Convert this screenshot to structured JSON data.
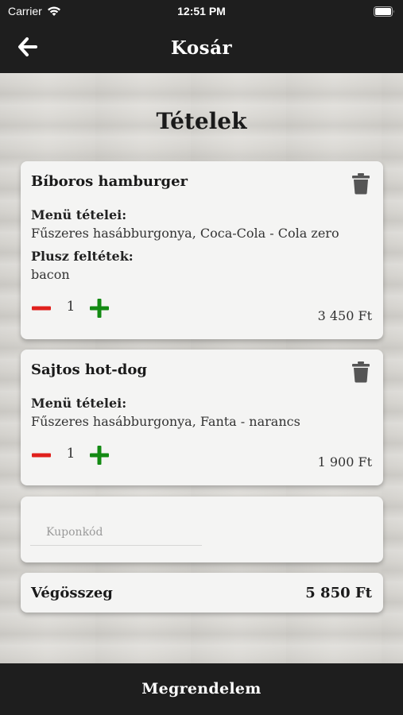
{
  "status_bar": {
    "carrier": "Carrier",
    "time": "12:51 PM"
  },
  "nav": {
    "title": "Kosár",
    "back_icon": "arrow-left-icon"
  },
  "section_title": "Tételek",
  "colors": {
    "dark": "#1e1e1e",
    "minus": "#e0201c",
    "plus": "#138a13",
    "trash": "#555555"
  },
  "items": [
    {
      "name": "Bíboros hamburger",
      "menu_label": "Menü tételei:",
      "menu_items": "Fűszeres hasábburgonya, Coca-Cola - Cola zero",
      "extras_label": "Plusz feltétek:",
      "extras": "bacon",
      "quantity": "1",
      "price": "3 450 Ft"
    },
    {
      "name": "Sajtos hot-dog",
      "menu_label": "Menü tételei:",
      "menu_items": "Fűszeres hasábburgonya, Fanta - narancs",
      "quantity": "1",
      "price": "1 900 Ft"
    }
  ],
  "coupon": {
    "placeholder": "Kuponkód",
    "value": ""
  },
  "total": {
    "label": "Végösszeg",
    "value": "5 850 Ft"
  },
  "order_button": {
    "label": "Megrendelem"
  }
}
